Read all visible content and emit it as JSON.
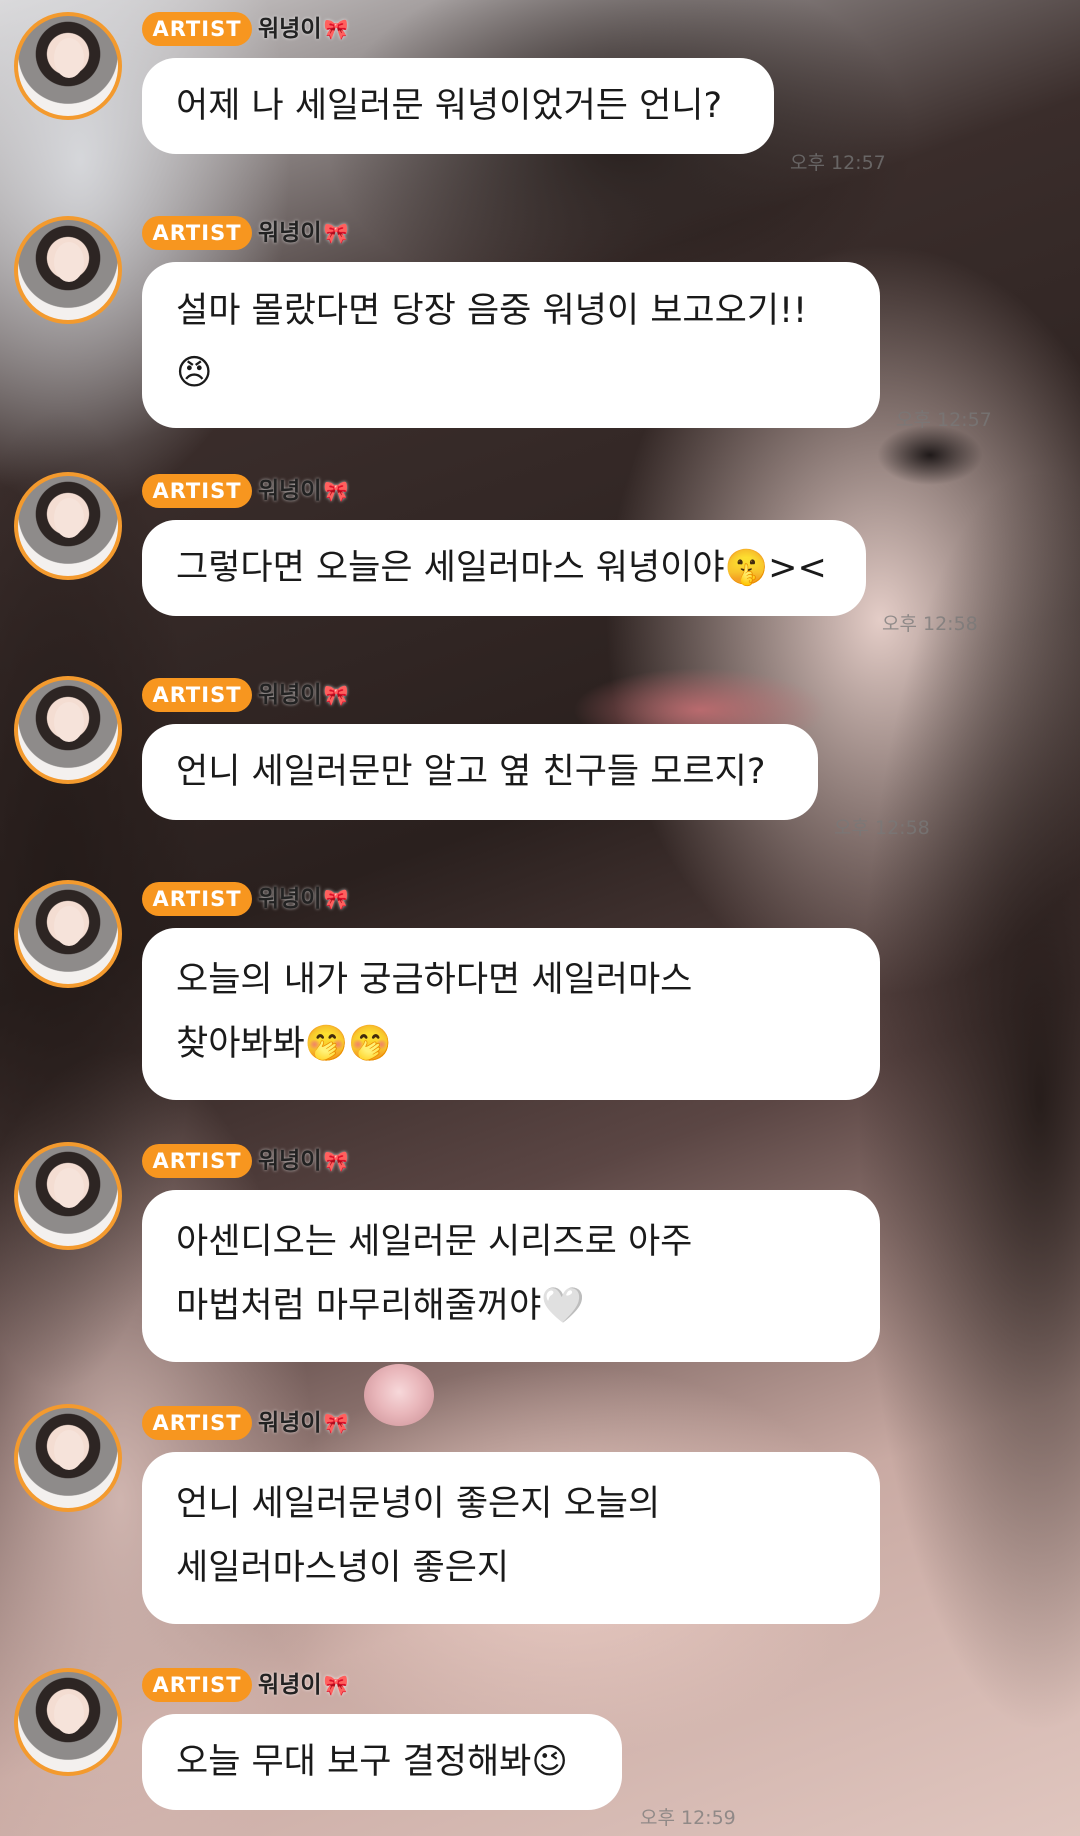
{
  "artist_badge": "ARTIST",
  "sender_name": "워녕이",
  "ribbon_icon": "🎀",
  "messages": [
    {
      "lines": [
        "어제 나 세일러문 워녕이었거든 언니?"
      ],
      "time": "오후 12:57"
    },
    {
      "lines": [
        "설마 몰랐다면 당장 음중 워녕이 보고오기!!",
        "😠"
      ],
      "time": "오후 12:57"
    },
    {
      "lines": [
        "그렇다면 오늘은 세일러마스 워녕이야🤫><"
      ],
      "time": "오후 12:58"
    },
    {
      "lines": [
        "언니 세일러문만 알고 옆 친구들 모르지?"
      ],
      "time": "오후 12:58"
    },
    {
      "lines": [
        "오늘의 내가 궁금하다면 세일러마스",
        "찾아봐봐🤭🤭"
      ],
      "time": ""
    },
    {
      "lines": [
        "아센디오는 세일러문 시리즈로 아주",
        "마법처럼 마무리해줄꺼야🤍"
      ],
      "time": ""
    },
    {
      "lines": [
        "언니 세일러문녕이 좋은지 오늘의",
        "세일러마스녕이 좋은지"
      ],
      "time": ""
    },
    {
      "lines": [
        "오늘 무대 보구 결정해봐😉"
      ],
      "time": "오후 12:59"
    }
  ]
}
